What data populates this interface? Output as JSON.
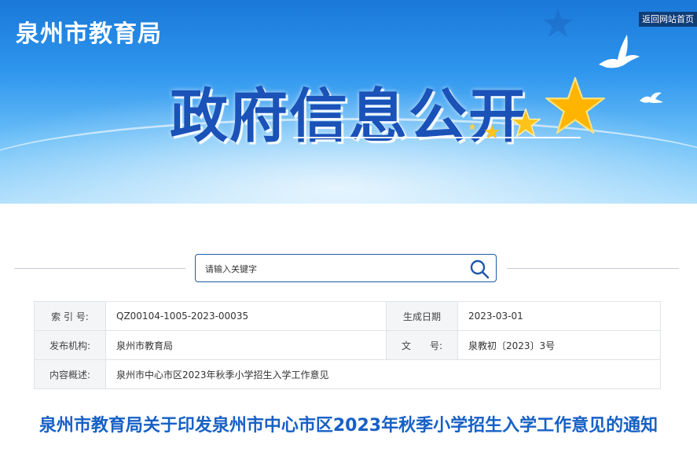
{
  "header": {
    "site_name": "泉州市教育局",
    "home_link": "返回网站首页",
    "banner_title": "政府信息公开"
  },
  "search": {
    "placeholder": "请输入关键字"
  },
  "meta": {
    "rows": [
      {
        "label1": "索 引 号:",
        "value1": "QZ00104-1005-2023-00035",
        "label2": "生成日期",
        "value2": "2023-03-01"
      },
      {
        "label1": "发布机构:",
        "value1": "泉州市教育局",
        "label2": "文　　号:",
        "value2": "泉教初〔2023〕3号"
      },
      {
        "label1": "内容概述:",
        "value1": "泉州市中心市区2023年秋季小学招生入学工作意见"
      }
    ]
  },
  "article": {
    "title": "泉州市教育局关于印发泉州市中心市区2023年秋季小学招生入学工作意见的通知"
  },
  "colors": {
    "banner_top": "#1a78d8",
    "headline": "#1a52b8",
    "title": "#1660c6",
    "home_link_bg": "#0e3d78",
    "star": "#ffb400"
  }
}
